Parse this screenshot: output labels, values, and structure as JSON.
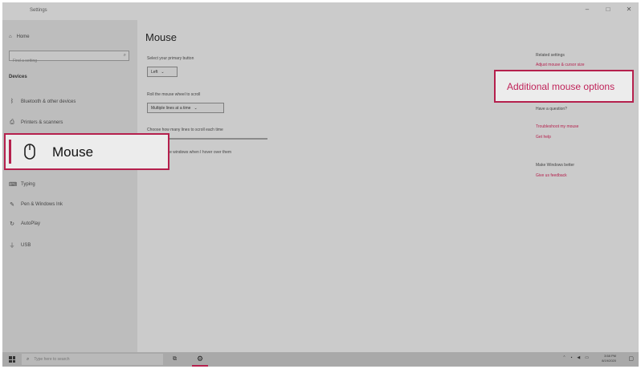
{
  "window": {
    "title": "Settings",
    "minimize": "–",
    "maximize": "□",
    "close": "✕"
  },
  "sidebar": {
    "home": "Home",
    "search_placeholder": "Find a setting",
    "section": "Devices",
    "items": [
      {
        "label": "Bluetooth & other devices",
        "icon": "bluetooth-icon"
      },
      {
        "label": "Printers & scanners",
        "icon": "printer-icon"
      },
      {
        "label": "Mouse",
        "icon": "mouse-icon"
      },
      {
        "label": "Typing",
        "icon": "keyboard-icon"
      },
      {
        "label": "Pen & Windows Ink",
        "icon": "pen-icon"
      },
      {
        "label": "AutoPlay",
        "icon": "autoplay-icon"
      },
      {
        "label": "USB",
        "icon": "usb-icon"
      }
    ]
  },
  "main": {
    "title": "Mouse",
    "primary_button_label": "Select your primary button",
    "primary_button_value": "Left",
    "scroll_label": "Roll the mouse wheel to scroll",
    "scroll_value": "Multiple lines at a time",
    "lines_label": "Choose how many lines to scroll each time",
    "inactive_label": "Scroll inactive windows when I hover over them",
    "inactive_value": "On"
  },
  "related": {
    "heading": "Related settings",
    "link1": "Adjust mouse & cursor size",
    "link_additional": "Additional mouse options",
    "question_heading": "Have a question?",
    "troubleshoot": "Troubleshoot my mouse",
    "get_help": "Get help",
    "better_heading": "Make Windows better",
    "feedback": "Give us feedback"
  },
  "taskbar": {
    "search_placeholder": "Type here to search",
    "time": "3:58 PM",
    "date": "8/19/2020"
  }
}
